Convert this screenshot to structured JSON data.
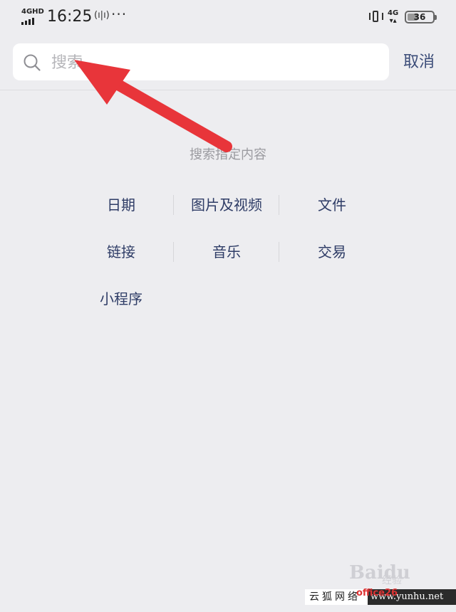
{
  "status_bar": {
    "network_label": "4GHD",
    "time": "16:25",
    "wave": "(ı|ı)",
    "dots": "···",
    "right_network": "4G",
    "battery": "36"
  },
  "search": {
    "placeholder": "搜索",
    "cancel_label": "取消"
  },
  "hint": "搜索指定内容",
  "categories": [
    [
      "日期",
      "图片及视频",
      "文件"
    ],
    [
      "链接",
      "音乐",
      "交易"
    ],
    [
      "小程序"
    ]
  ],
  "watermark": {
    "left": "云狐网络",
    "right": "www.yunhu.net",
    "logo": "Baidu",
    "logo_sub": "经验",
    "red": "office26"
  },
  "colors": {
    "background": "#ededf0",
    "accent_text": "#2e3c66",
    "arrow": "#e8353a"
  }
}
